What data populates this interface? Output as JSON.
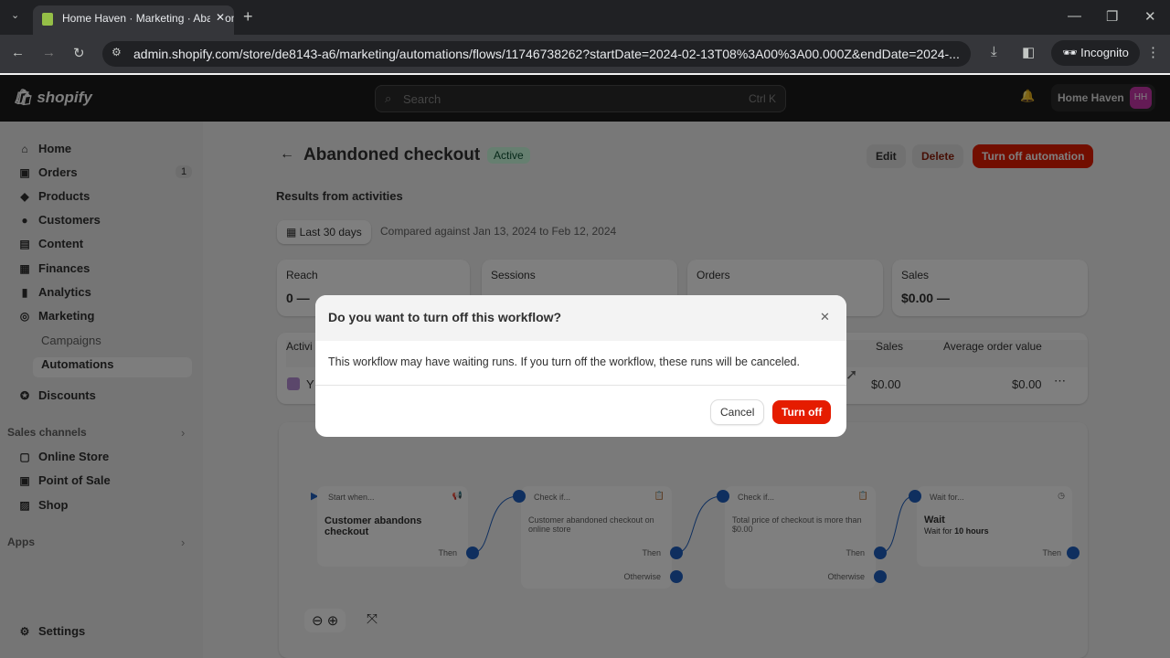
{
  "browser": {
    "tab_title": "Home Haven · Marketing · Abandoned checkout",
    "url": "admin.shopify.com/store/de8143-a6/marketing/automations/flows/11746738262?startDate=2024-02-13T08%3A00%3A00.000Z&endDate=2024-...",
    "incognito": "Incognito"
  },
  "topbar": {
    "logo": "shopify",
    "search_placeholder": "Search",
    "shortcut": "Ctrl K",
    "store": "Home Haven",
    "avatar": "HH",
    "accent": "#c837ab"
  },
  "sidebar": {
    "items": [
      {
        "label": "Home",
        "icon": "home-icon"
      },
      {
        "label": "Orders",
        "icon": "orders-icon",
        "badge": "1"
      },
      {
        "label": "Products",
        "icon": "tag-icon"
      },
      {
        "label": "Customers",
        "icon": "person-icon"
      },
      {
        "label": "Content",
        "icon": "content-icon"
      },
      {
        "label": "Finances",
        "icon": "bank-icon"
      },
      {
        "label": "Analytics",
        "icon": "chart-icon"
      },
      {
        "label": "Marketing",
        "icon": "target-icon"
      }
    ],
    "marketing_sub": [
      "Campaigns",
      "Automations"
    ],
    "discounts": "Discounts",
    "sales_channels": "Sales channels",
    "channels": [
      "Online Store",
      "Point of Sale",
      "Shop"
    ],
    "apps": "Apps",
    "settings": "Settings"
  },
  "page": {
    "title": "Abandoned checkout",
    "status": "Active",
    "edit": "Edit",
    "delete": "Delete",
    "turn_off": "Turn off automation",
    "section": "Results from activities",
    "date_range": "Last 30 days",
    "compared": "Compared against Jan 13, 2024 to Feb 12, 2024",
    "metrics": [
      {
        "label": "Reach",
        "value": "0 —"
      },
      {
        "label": "Sessions",
        "value": ""
      },
      {
        "label": "Orders",
        "value": ""
      },
      {
        "label": "Sales",
        "value": "$0.00 —"
      }
    ],
    "table": {
      "headers": [
        "Activi",
        "Sales",
        "Average order value"
      ],
      "row": {
        "name": "Y",
        "sales": "$0.00",
        "aov": "$0.00"
      }
    }
  },
  "flow": {
    "nodes": [
      {
        "header": "Start when...",
        "title": "Customer abandons checkout",
        "then": "Then"
      },
      {
        "header": "Check if...",
        "body": "Customer abandoned checkout on online store",
        "then": "Then",
        "otherwise": "Otherwise"
      },
      {
        "header": "Check if...",
        "body": "Total price of checkout is more than $0.00",
        "then": "Then",
        "otherwise": "Otherwise"
      },
      {
        "header": "Wait for...",
        "title": "Wait",
        "body": "Wait for ",
        "bold": "10 hours",
        "then": "Then"
      }
    ]
  },
  "modal": {
    "title": "Do you want to turn off this workflow?",
    "body": "This workflow may have waiting runs. If you turn off the workflow, these runs will be canceled.",
    "cancel": "Cancel",
    "confirm": "Turn off",
    "danger_color": "#e51c00"
  }
}
